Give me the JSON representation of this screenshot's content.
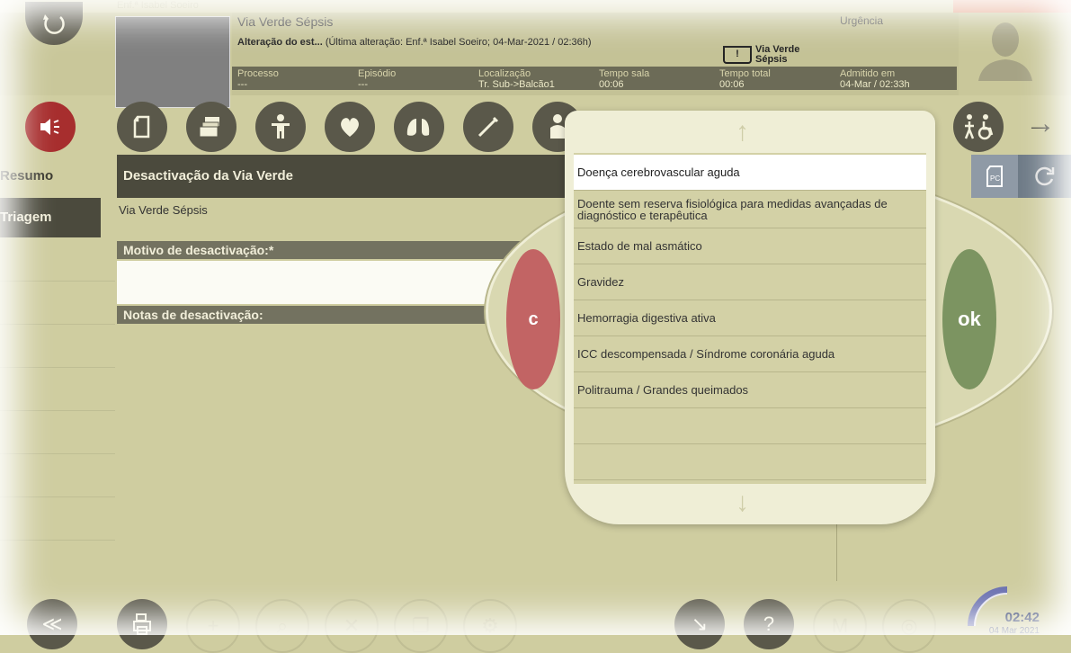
{
  "header": {
    "faint_user": "Enf.ª Isabel Soeiro",
    "title": "Via Verde Sépsis",
    "urgency": "Urgência",
    "alteration_bold": "Alteração do est...",
    "alteration_rest": " (Última alteração: Enf.ª Isabel Soeiro; 04-Mar-2021 / 02:36h)",
    "badge_icon": "!",
    "badge_line1": "Via Verde",
    "badge_line2": "Sépsis",
    "info": [
      {
        "label": "Processo",
        "value": "---"
      },
      {
        "label": "Episódio",
        "value": "---"
      },
      {
        "label": "Localização",
        "value": "Tr. Sub->Balcão1"
      },
      {
        "label": "Tempo sala",
        "value": "00:06"
      },
      {
        "label": "Tempo total",
        "value": "00:06"
      },
      {
        "label": "Admitido em",
        "value": "04-Mar / 02:33h"
      }
    ]
  },
  "sidebar": {
    "items": [
      {
        "label": "Resumo"
      },
      {
        "label": "Triagem"
      }
    ]
  },
  "main": {
    "title": "Desactivação da Via Verde",
    "via_verde": "Via Verde Sépsis",
    "motivo_label": "Motivo de desactivação:*",
    "notas_label": "Notas de desactivação:"
  },
  "popup": {
    "cancel_label": "c",
    "ok_label": "ok",
    "up_arrow": "↑",
    "down_arrow": "↓",
    "options": [
      "Doença cerebrovascular aguda",
      "Doente sem reserva fisiológica para medidas avançadas de diagnóstico e terapêutica",
      "Estado de mal asmático",
      "Gravidez",
      "Hemorragia digestiva ativa",
      "ICC descompensada / Síndrome coronária aguda",
      "Politrauma / Grandes queimados"
    ],
    "selected": "Doença cerebrovascular aguda"
  },
  "toolbar": {
    "right_arrow": "→"
  },
  "status": {
    "time": "02:42",
    "date": "04 Mar 2021"
  },
  "colors": {
    "background": "#cfcda0",
    "header_dark": "#4b4a3d",
    "cancel": "#c26464",
    "ok": "#7c9461",
    "alert": "#a72e2e"
  }
}
